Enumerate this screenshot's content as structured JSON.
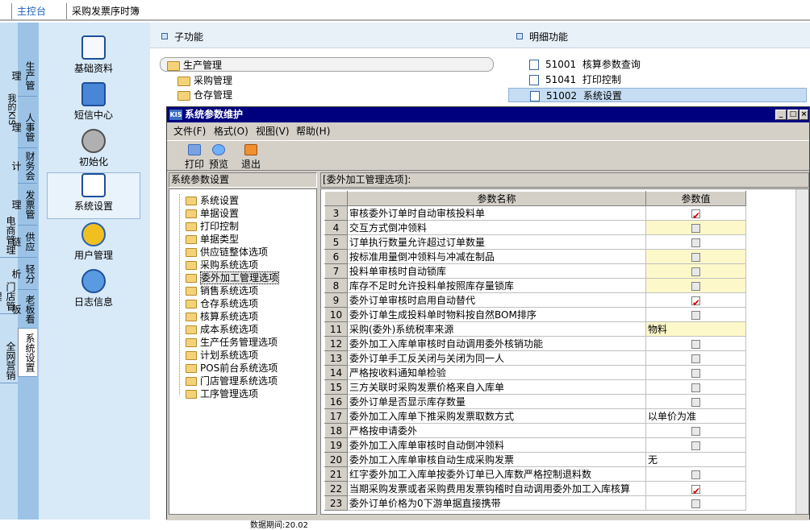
{
  "tabs": {
    "main": "主控台",
    "invoice": "采购发票序时簿"
  },
  "left_strip_text": "我的KIS",
  "vertical_tabs": [
    "生产管理",
    "人事管理",
    "财务会计",
    "发票管理",
    "供应链",
    "轻分析",
    "电商管理",
    "老板看板",
    "门店管理",
    "系统设置",
    "全网营销"
  ],
  "icon_items": [
    {
      "label": "基础资料"
    },
    {
      "label": "短信中心"
    },
    {
      "label": "初始化"
    },
    {
      "label": "系统设置"
    },
    {
      "label": "用户管理"
    },
    {
      "label": "日志信息"
    }
  ],
  "sub_header": "子功能",
  "detail_header": "明细功能",
  "sub_items": [
    "生产管理",
    "采购管理",
    "仓存管理"
  ],
  "detail_items": [
    {
      "code": "51001",
      "name": "核算参数查询"
    },
    {
      "code": "51041",
      "name": "打印控制"
    },
    {
      "code": "51002",
      "name": "系统设置"
    }
  ],
  "dialog": {
    "title": "系统参数维护",
    "kis": "KIS",
    "menu": [
      "文件(F)",
      "格式(O)",
      "视图(V)",
      "帮助(H)"
    ],
    "toolbar": [
      "打印",
      "预览",
      "退出"
    ],
    "left_header": "系统参数设置",
    "right_header": "[委外加工管理选项]:",
    "tree": [
      "系统设置",
      "单据设置",
      "打印控制",
      "单据类型",
      "供应链整体选项",
      "采购系统选项",
      "委外加工管理选项",
      "销售系统选项",
      "仓存系统选项",
      "核算系统选项",
      "成本系统选项",
      "生产任务管理选项",
      "计划系统选项",
      "POS前台系统选项",
      "门店管理系统选项",
      "工序管理选项"
    ],
    "tree_selected": 6,
    "columns": {
      "name": "参数名称",
      "value": "参数值"
    },
    "rows": [
      {
        "num": "3",
        "name": "审核委外订单时自动审核投料单",
        "value": "checked"
      },
      {
        "num": "4",
        "name": "交互方式倒冲领料",
        "value": "unchecked",
        "yellow": true
      },
      {
        "num": "5",
        "name": "订单执行数量允许超过订单数量",
        "value": "unchecked"
      },
      {
        "num": "6",
        "name": "按标准用量倒冲领料与冲减在制品",
        "value": "unchecked",
        "yellow": true
      },
      {
        "num": "7",
        "name": "投料单审核时自动锁库",
        "value": "unchecked",
        "yellow": true
      },
      {
        "num": "8",
        "name": "库存不足时允许投料单按照库存量锁库",
        "value": "unchecked",
        "yellow": true
      },
      {
        "num": "9",
        "name": "委外订单审核时启用自动替代",
        "value": "checked"
      },
      {
        "num": "10",
        "name": "委外订单生成投料单时物料按自然BOM排序",
        "value": "unchecked"
      },
      {
        "num": "11",
        "name": "采购(委外)系统税率来源",
        "value": "物料",
        "yellow": true
      },
      {
        "num": "12",
        "name": "委外加工入库单审核时自动调用委外核销功能",
        "value": "unchecked"
      },
      {
        "num": "13",
        "name": "委外订单手工反关闭与关闭为同一人",
        "value": "unchecked"
      },
      {
        "num": "14",
        "name": "严格按收料通知单检验",
        "value": "unchecked"
      },
      {
        "num": "15",
        "name": "三方关联时采购发票价格来自入库单",
        "value": "unchecked"
      },
      {
        "num": "16",
        "name": "委外订单是否显示库存数量",
        "value": "unchecked"
      },
      {
        "num": "17",
        "name": "委外加工入库单下推采购发票取数方式",
        "value": "以单价为准"
      },
      {
        "num": "18",
        "name": "严格按申请委外",
        "value": "unchecked"
      },
      {
        "num": "19",
        "name": "委外加工入库单审核时自动倒冲领料",
        "value": "unchecked"
      },
      {
        "num": "20",
        "name": "委外加工入库单审核自动生成采购发票",
        "value": "无"
      },
      {
        "num": "21",
        "name": "红字委外加工入库单按委外订单已入库数严格控制退料数",
        "value": "unchecked"
      },
      {
        "num": "22",
        "name": "当期采购发票或者采购费用发票钩稽时自动调用委外加工入库核算",
        "value": "checked"
      },
      {
        "num": "23",
        "name": "委外订单价格为0下游单据直接携带",
        "value": "unchecked"
      }
    ]
  },
  "status_text": "数据期间:20.02"
}
